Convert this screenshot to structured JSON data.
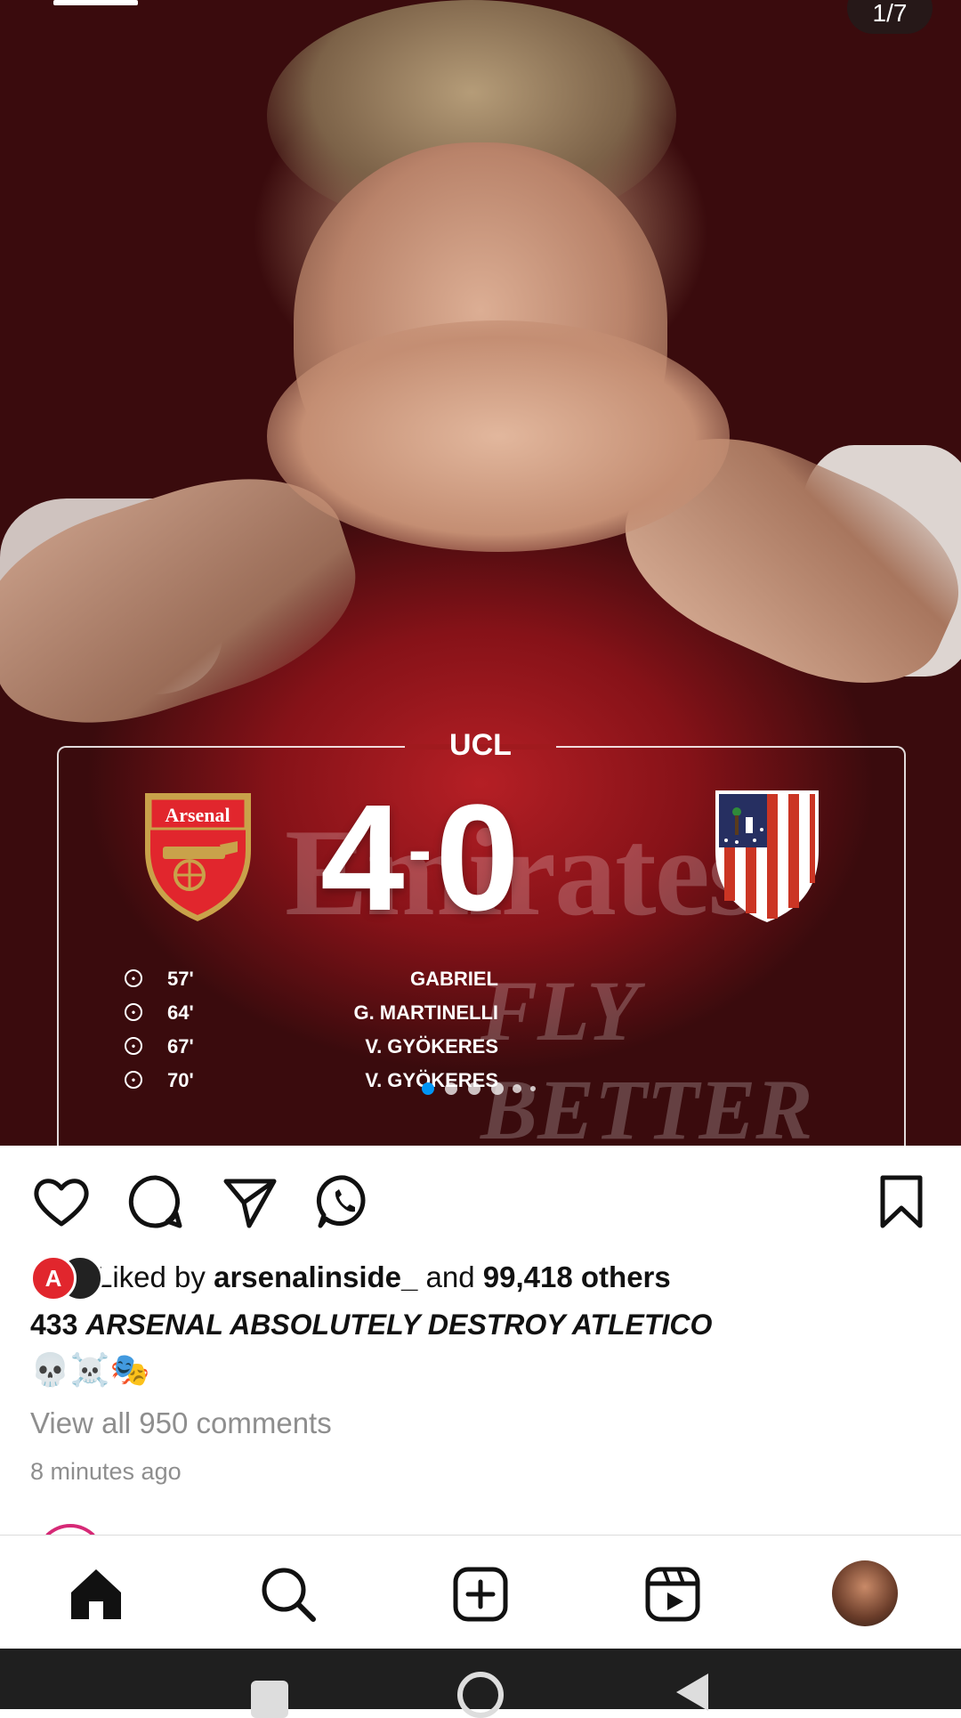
{
  "post": {
    "image_counter": "1/7",
    "scoreboard": {
      "competition": "UCL",
      "home_score": "4",
      "separator": "-",
      "away_score": "0",
      "home_crest_text": "Arsenal",
      "goals": [
        {
          "minute": "57'",
          "scorer": "GABRIEL"
        },
        {
          "minute": "64'",
          "scorer": "G. MARTINELLI"
        },
        {
          "minute": "67'",
          "scorer": "V. GYÖKERES"
        },
        {
          "minute": "70'",
          "scorer": "V. GYÖKERES"
        }
      ],
      "sponsor_text": "Emirates",
      "sponsor_sub": "FLY BETTER"
    },
    "carousel": {
      "count": 6,
      "active_index": 0,
      "active_color": "#0095f6"
    },
    "likes": {
      "prefix": "Liked by ",
      "user": "arsenalinside_",
      "middle": " and ",
      "count": "99,418 others"
    },
    "caption": {
      "account": "433",
      "text": "ARSENAL ABSOLUTELY DESTROY ATLETICO"
    },
    "emojis": "💀☠️🎭",
    "comments_link": "View all 950 comments",
    "time_ago": "8 minutes ago"
  },
  "icons": {
    "like": "heart-icon",
    "comment": "comment-icon",
    "share": "send-icon",
    "whatsapp": "whatsapp-icon",
    "save": "bookmark-icon"
  },
  "nav": [
    "home-icon",
    "search-icon",
    "create-icon",
    "reels-icon",
    "profile-avatar"
  ],
  "colors": {
    "arsenal_red": "#e1262d",
    "atletico_red": "#cb3524",
    "atletico_blue": "#262f61",
    "accent": "#0095f6"
  }
}
